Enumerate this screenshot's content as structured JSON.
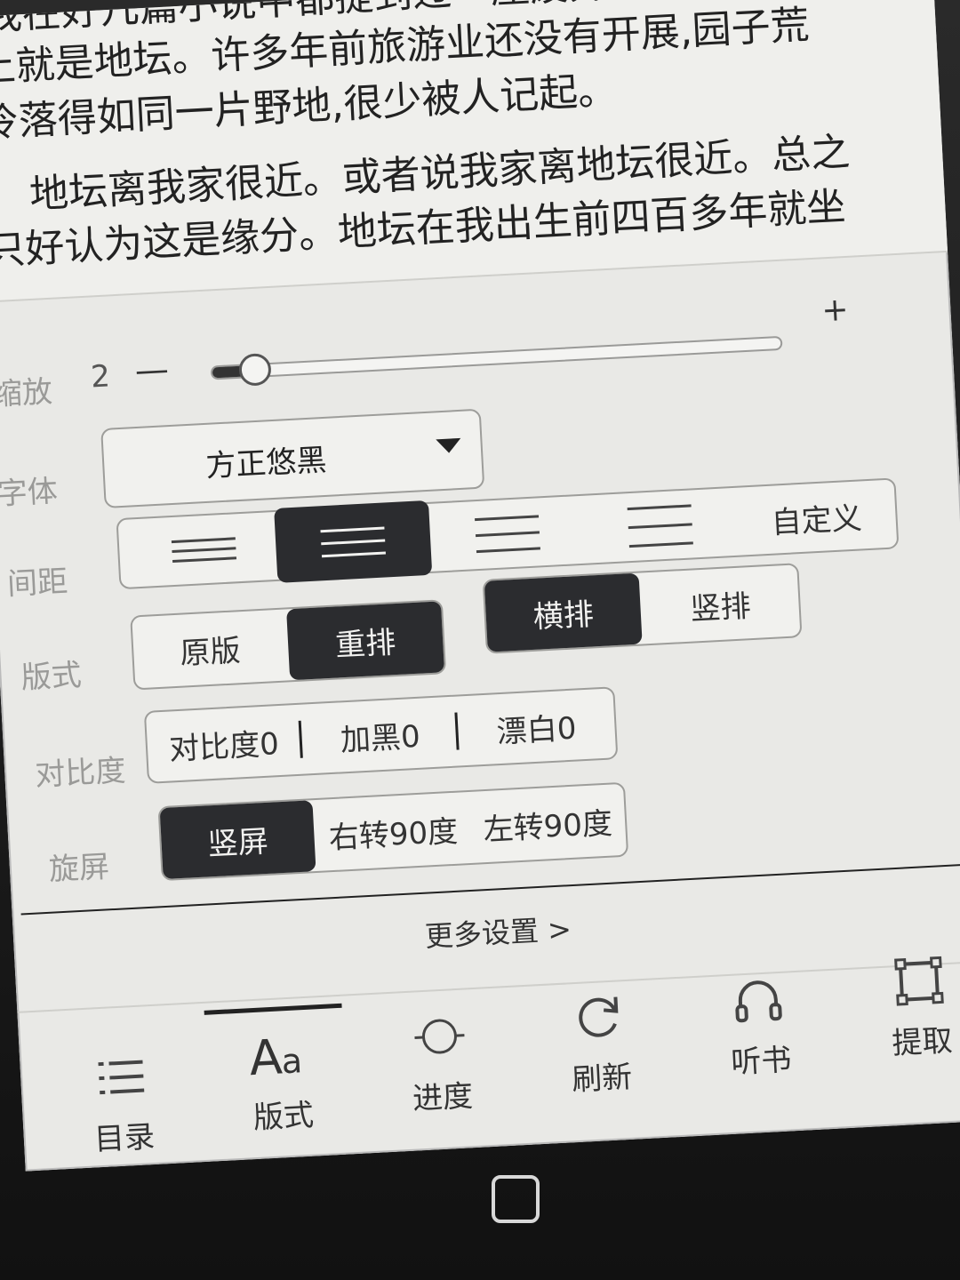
{
  "reading": {
    "line0": "我在好几篇小说中都提到过一座废弃的古园,实际",
    "line1": "上就是地坛。许多年前旅游业还没有开展,园子荒",
    "line2": "冷落得如同一片野地,很少被人记起。",
    "line3": "地坛离我家很近。或者说我家离地坛很近。总之",
    "line4": "只好认为这是缘分。地坛在我出生前四百多年就坐"
  },
  "zoom": {
    "label": "缩放",
    "value": "2",
    "minus": "—",
    "plus": "+",
    "level": 0.07
  },
  "font": {
    "label": "字体",
    "selected": "方正悠黑"
  },
  "spacing": {
    "label": "间距",
    "custom": "自定义",
    "selected_index": 1
  },
  "layout": {
    "label": "版式",
    "original": "原版",
    "reflow": "重排",
    "horizontal": "横排",
    "vertical": "竖排"
  },
  "contrast": {
    "label": "对比度",
    "contrast": "对比度0",
    "darken": "加黑0",
    "whiten": "漂白0"
  },
  "rotate": {
    "label": "旋屏",
    "portrait": "竖屏",
    "right90": "右转90度",
    "left90": "左转90度"
  },
  "more_settings": "更多设置 >",
  "tabs": [
    {
      "label": "目录",
      "icon": "list-icon"
    },
    {
      "label": "版式",
      "icon": "font-aa-icon"
    },
    {
      "label": "进度",
      "icon": "progress-circle-icon"
    },
    {
      "label": "刷新",
      "icon": "refresh-icon"
    },
    {
      "label": "听书",
      "icon": "headphones-icon"
    },
    {
      "label": "提取",
      "icon": "crop-extract-icon"
    }
  ],
  "active_tab": "版式"
}
